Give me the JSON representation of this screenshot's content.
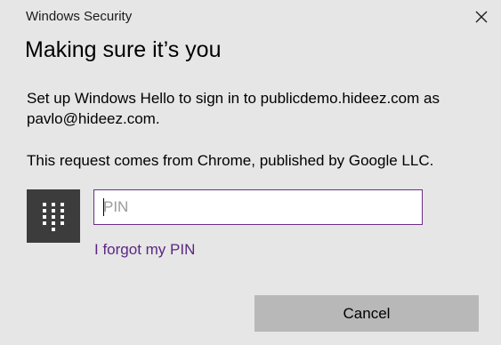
{
  "window": {
    "title": "Windows Security",
    "close_icon": "close-icon"
  },
  "dialog": {
    "heading": "Making sure it’s you",
    "message": "Set up Windows Hello to sign in to publicdemo.hideez.com as pavlo@hideez.com.",
    "source": "This request comes from Chrome, published by Google LLC."
  },
  "pin": {
    "icon": "keypad-icon",
    "value": "",
    "placeholder": "PIN",
    "forgot_label": "I forgot my PIN"
  },
  "actions": {
    "cancel_label": "Cancel"
  },
  "colors": {
    "background": "#e6e6e6",
    "accent": "#6b2d8a",
    "link": "#5b2782",
    "button": "#b8b8b8",
    "keypad_tile": "#3c3c3c"
  }
}
